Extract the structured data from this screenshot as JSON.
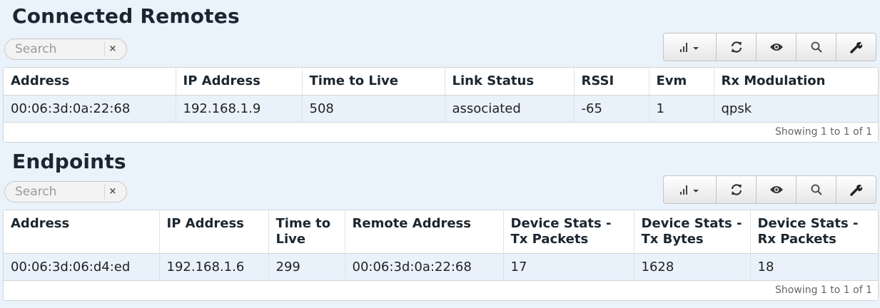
{
  "connected_remotes": {
    "title": "Connected Remotes",
    "search_placeholder": "Search",
    "clear_glyph": "×",
    "toolbar": {
      "icons": [
        "signal-icon",
        "refresh-icon",
        "eye-icon",
        "search-icon",
        "wrench-icon"
      ]
    },
    "columns": [
      "Address",
      "IP Address",
      "Time to Live",
      "Link Status",
      "RSSI",
      "Evm",
      "Rx Modulation"
    ],
    "rows": [
      [
        "00:06:3d:0a:22:68",
        "192.168.1.9",
        "508",
        "associated",
        "-65",
        "1",
        "qpsk"
      ]
    ],
    "footer": "Showing 1 to 1 of 1"
  },
  "endpoints": {
    "title": "Endpoints",
    "search_placeholder": "Search",
    "clear_glyph": "×",
    "toolbar": {
      "icons": [
        "signal-icon",
        "refresh-icon",
        "eye-icon",
        "search-icon",
        "wrench-icon"
      ]
    },
    "columns": [
      "Address",
      "IP Address",
      "Time to Live",
      "Remote Address",
      "Device Stats - Tx Packets",
      "Device Stats - Tx Bytes",
      "Device Stats - Rx Packets"
    ],
    "rows": [
      [
        "00:06:3d:06:d4:ed",
        "192.168.1.6",
        "299",
        "00:06:3d:0a:22:68",
        "17",
        "1628",
        "18"
      ]
    ],
    "footer": "Showing 1 to 1 of 1"
  }
}
